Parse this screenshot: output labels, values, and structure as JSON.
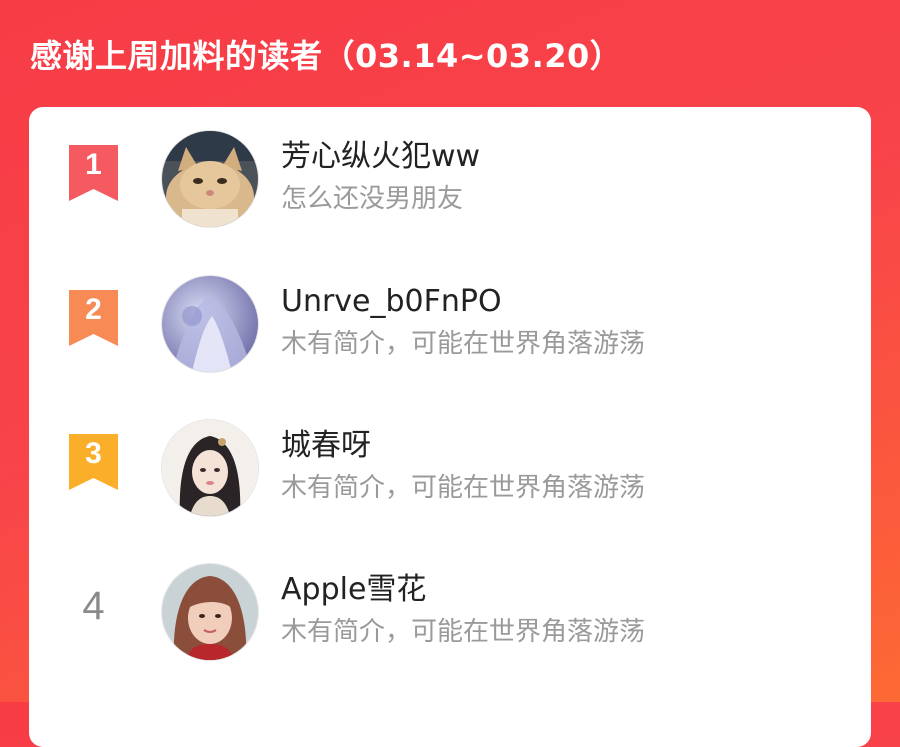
{
  "header": {
    "title": "感谢上周加料的读者（03.14~03.20）"
  },
  "colors": {
    "rank1": "#f45a5f",
    "rank2": "#f88a55",
    "rank3": "#fbae2a",
    "background": "#f73c46"
  },
  "readers": [
    {
      "rank": "1",
      "name": "芳心纵火犯ww",
      "bio": "怎么还没男朋友",
      "avatar": "cat-avatar"
    },
    {
      "rank": "2",
      "name": "Unrve_b0FnPO",
      "bio": "木有简介，可能在世界角落游荡",
      "avatar": "anime-purple-avatar"
    },
    {
      "rank": "3",
      "name": "城春呀",
      "bio": "木有简介，可能在世界角落游荡",
      "avatar": "ancient-girl-avatar"
    },
    {
      "rank": "4",
      "name": "Apple雪花",
      "bio": "木有简介，可能在世界角落游荡",
      "avatar": "selfie-avatar"
    }
  ]
}
